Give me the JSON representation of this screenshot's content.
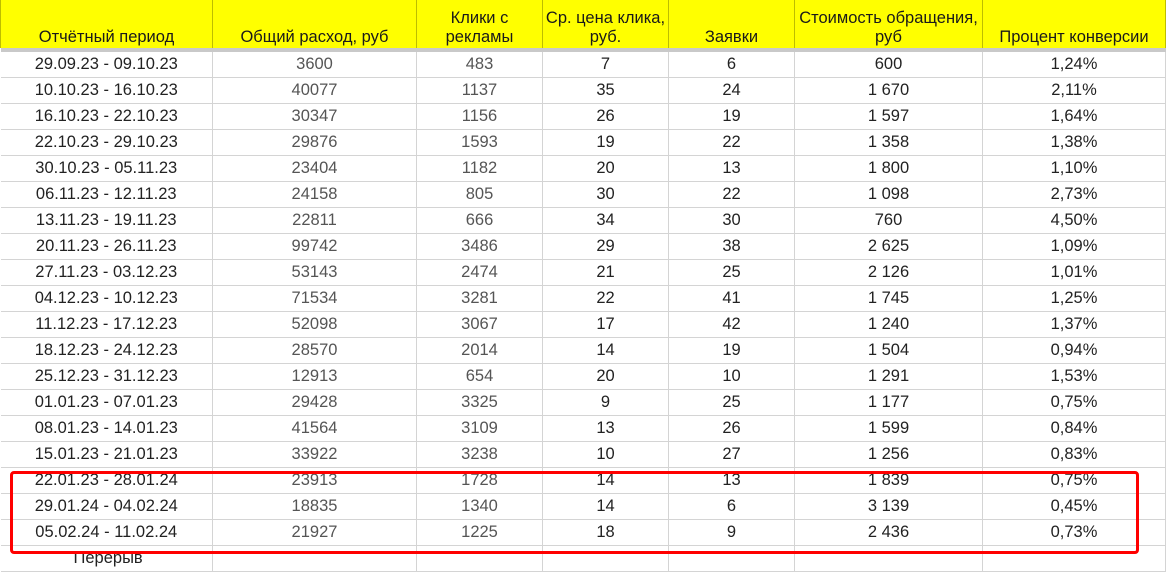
{
  "columns": [
    "Отчётный период",
    "Общий расход, руб",
    "Клики с рекламы",
    "Ср. цена клика, руб.",
    "Заявки",
    "Стоимость обращения, руб",
    "Процент конверсии"
  ],
  "rows": [
    [
      "29.09.23 - 09.10.23",
      "3600",
      "483",
      "7",
      "6",
      "600",
      "1,24%"
    ],
    [
      "10.10.23 - 16.10.23",
      "40077",
      "1137",
      "35",
      "24",
      "1 670",
      "2,11%"
    ],
    [
      "16.10.23 - 22.10.23",
      "30347",
      "1156",
      "26",
      "19",
      "1 597",
      "1,64%"
    ],
    [
      "22.10.23 - 29.10.23",
      "29876",
      "1593",
      "19",
      "22",
      "1 358",
      "1,38%"
    ],
    [
      "30.10.23 - 05.11.23",
      "23404",
      "1182",
      "20",
      "13",
      "1 800",
      "1,10%"
    ],
    [
      "06.11.23 - 12.11.23",
      "24158",
      "805",
      "30",
      "22",
      "1 098",
      "2,73%"
    ],
    [
      "13.11.23 - 19.11.23",
      "22811",
      "666",
      "34",
      "30",
      "760",
      "4,50%"
    ],
    [
      "20.11.23 -  26.11.23",
      "99742",
      "3486",
      "29",
      "38",
      "2 625",
      "1,09%"
    ],
    [
      "27.11.23 - 03.12.23",
      "53143",
      "2474",
      "21",
      "25",
      "2 126",
      "1,01%"
    ],
    [
      "04.12.23 - 10.12.23",
      "71534",
      "3281",
      "22",
      "41",
      "1 745",
      "1,25%"
    ],
    [
      "11.12.23 - 17.12.23",
      "52098",
      "3067",
      "17",
      "42",
      "1 240",
      "1,37%"
    ],
    [
      "18.12.23 - 24.12.23",
      "28570",
      "2014",
      "14",
      "19",
      "1 504",
      "0,94%"
    ],
    [
      "25.12.23 - 31.12.23",
      "12913",
      "654",
      "20",
      "10",
      "1 291",
      "1,53%"
    ],
    [
      "01.01.23 - 07.01.23",
      "29428",
      "3325",
      "9",
      "25",
      "1 177",
      "0,75%"
    ],
    [
      "08.01.23 - 14.01.23",
      "41564",
      "3109",
      "13",
      "26",
      "1 599",
      "0,84%"
    ],
    [
      "15.01.23 - 21.01.23",
      "33922",
      "3238",
      "10",
      "27",
      "1 256",
      "0,83%"
    ],
    [
      "22.01.23 - 28.01.24",
      "23913",
      "1728",
      "14",
      "13",
      "1 839",
      "0,75%"
    ],
    [
      "29.01.24 - 04.02.24",
      "18835",
      "1340",
      "14",
      "6",
      "3 139",
      "0,45%"
    ],
    [
      "05.02.24 - 11.02.24",
      "21927",
      "1225",
      "18",
      "9",
      "2 436",
      "0,73%"
    ]
  ],
  "footer_note": "Перерыв",
  "colors": {
    "header_background": "#ffff00",
    "highlight_border": "#ff0000",
    "gridline": "#d4d4d4"
  }
}
